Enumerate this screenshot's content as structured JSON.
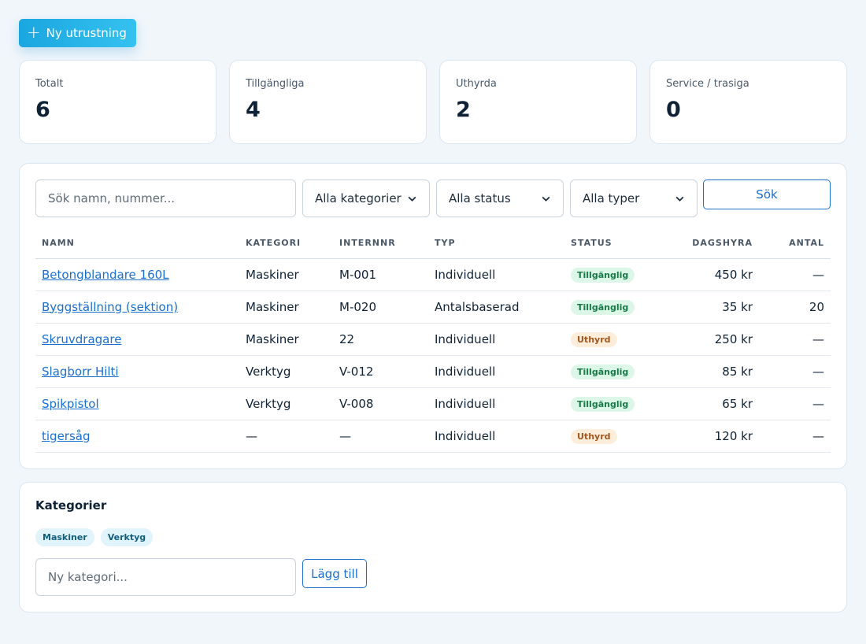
{
  "toolbar": {
    "new_label": "Ny utrustning",
    "new_icon": "plus-icon"
  },
  "stats": [
    {
      "label": "Totalt",
      "value": "6"
    },
    {
      "label": "Tillgängliga",
      "value": "4"
    },
    {
      "label": "Uthyrda",
      "value": "2"
    },
    {
      "label": "Service / trasiga",
      "value": "0"
    }
  ],
  "filters": {
    "search_placeholder": "Sök namn, nummer...",
    "category_selected": "Alla kategorier",
    "status_selected": "Alla status",
    "type_selected": "Alla typer",
    "search_button": "Sök"
  },
  "table": {
    "columns": [
      "NAMN",
      "KATEGORI",
      "INTERNNR",
      "TYP",
      "STATUS",
      "DAGSHYRA",
      "ANTAL"
    ],
    "rows": [
      {
        "name": "Betongblandare 160L",
        "category": "Maskiner",
        "internal": "M-001",
        "type": "Individuell",
        "status": "Tillgänglig",
        "daily": "450 kr",
        "qty": "—"
      },
      {
        "name": "Byggställning (sektion)",
        "category": "Maskiner",
        "internal": "M-020",
        "type": "Antalsbaserad",
        "status": "Tillgänglig",
        "daily": "35 kr",
        "qty": "20"
      },
      {
        "name": "Skruvdragare",
        "category": "Maskiner",
        "internal": "22",
        "type": "Individuell",
        "status": "Uthyrd",
        "daily": "250 kr",
        "qty": "—"
      },
      {
        "name": "Slagborr Hilti",
        "category": "Verktyg",
        "internal": "V-012",
        "type": "Individuell",
        "status": "Tillgänglig",
        "daily": "85 kr",
        "qty": "—"
      },
      {
        "name": "Spikpistol",
        "category": "Verktyg",
        "internal": "V-008",
        "type": "Individuell",
        "status": "Tillgänglig",
        "daily": "65 kr",
        "qty": "—"
      },
      {
        "name": "tigersåg",
        "category": "—",
        "internal": "—",
        "type": "Individuell",
        "status": "Uthyrd",
        "daily": "120 kr",
        "qty": "—"
      }
    ]
  },
  "categories": {
    "title": "Kategorier",
    "chips": [
      "Maskiner",
      "Verktyg"
    ],
    "input_placeholder": "Ny kategori...",
    "add_button": "Lägg till"
  },
  "colors": {
    "accent": "#1a6fd1",
    "primary_button": "#1aa6df",
    "status_available_bg": "#dcf6e7",
    "status_available_fg": "#177a47",
    "status_rented_bg": "#fdeedb",
    "status_rented_fg": "#a5561d"
  }
}
